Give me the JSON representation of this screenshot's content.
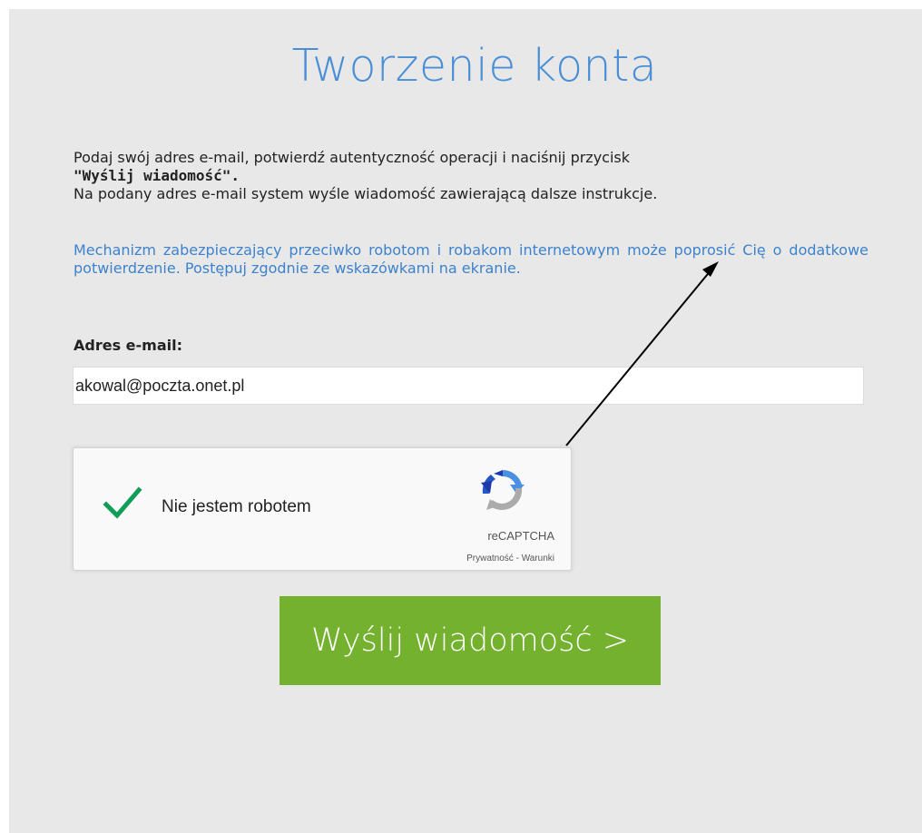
{
  "page": {
    "title": "Tworzenie konta"
  },
  "instructions": {
    "line1": "Podaj swój adres e-mail, potwierdź autentyczność operacji i naciśnij przycisk",
    "line1_bold": "\"Wyślij wiadomość\".",
    "line2": "Na podany adres e-mail system wyśle wiadomość zawierającą dalsze instrukcje."
  },
  "notice": {
    "text": "Mechanizm zabezpieczający przeciwko robotom i robakom internetowym może poprosić Cię o dodatkowe potwierdzenie. Postępuj zgodnie ze wskazówkami na ekranie."
  },
  "email": {
    "label": "Adres e-mail:",
    "value": "akowal@poczta.onet.pl"
  },
  "captcha": {
    "label": "Nie jestem robotem",
    "brand": "reCAPTCHA",
    "terms": "Prywatność - Warunki",
    "checked": true,
    "check_color": "#0f9d58",
    "icon": "recaptcha-logo-icon"
  },
  "submit": {
    "label": "Wyślij wiadomość >",
    "color": "#74b12f"
  },
  "colors": {
    "title": "#4a8fd6",
    "notice": "#3d82cc",
    "background": "#e8e8e8"
  }
}
